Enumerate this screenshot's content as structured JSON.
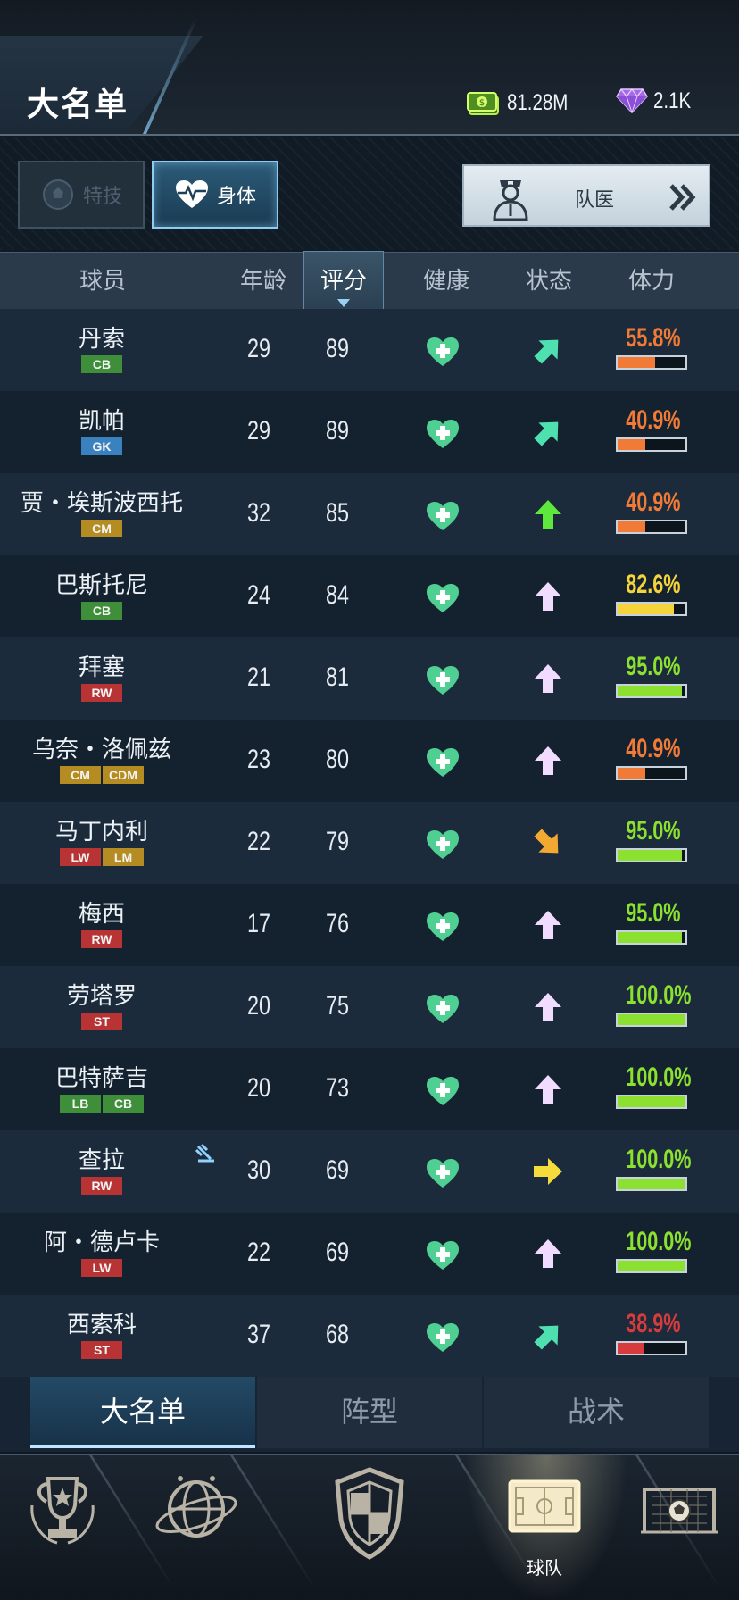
{
  "header": {
    "title": "大名单",
    "money": "81.28M",
    "gems": "2.1K",
    "icons": [
      "cash-icon",
      "diamond-icon"
    ]
  },
  "controls": {
    "tab_skill": "特技",
    "tab_body": "身体",
    "doctor_button": "队医"
  },
  "table": {
    "columns": [
      "球员",
      "年龄",
      "评分",
      "健康",
      "状态",
      "体力"
    ],
    "players": [
      {
        "name": "丹索",
        "positions": [
          "CB"
        ],
        "age": "29",
        "rating": "89",
        "mood": "up-right",
        "stamina": "55.8%",
        "stamina_value": 55.8
      },
      {
        "name": "凯帕",
        "positions": [
          "GK"
        ],
        "age": "29",
        "rating": "89",
        "mood": "up-right",
        "stamina": "40.9%",
        "stamina_value": 40.9
      },
      {
        "name": "贾・埃斯波西托",
        "positions": [
          "CM"
        ],
        "age": "32",
        "rating": "85",
        "mood": "up-green",
        "stamina": "40.9%",
        "stamina_value": 40.9
      },
      {
        "name": "巴斯托尼",
        "positions": [
          "CB"
        ],
        "age": "24",
        "rating": "84",
        "mood": "up",
        "stamina": "82.6%",
        "stamina_value": 82.6
      },
      {
        "name": "拜塞",
        "positions": [
          "RW"
        ],
        "age": "21",
        "rating": "81",
        "mood": "up",
        "stamina": "95.0%",
        "stamina_value": 95.0
      },
      {
        "name": "乌奈・洛佩兹",
        "positions": [
          "CM",
          "CDM"
        ],
        "age": "23",
        "rating": "80",
        "mood": "up",
        "stamina": "40.9%",
        "stamina_value": 40.9
      },
      {
        "name": "马丁内利",
        "positions": [
          "LW",
          "LM"
        ],
        "age": "22",
        "rating": "79",
        "mood": "down-right",
        "stamina": "95.0%",
        "stamina_value": 95.0
      },
      {
        "name": "梅西",
        "positions": [
          "RW"
        ],
        "age": "17",
        "rating": "76",
        "mood": "up",
        "stamina": "95.0%",
        "stamina_value": 95.0
      },
      {
        "name": "劳塔罗",
        "positions": [
          "ST"
        ],
        "age": "20",
        "rating": "75",
        "mood": "up",
        "stamina": "100.0%",
        "stamina_value": 100.0
      },
      {
        "name": "巴特萨吉",
        "positions": [
          "LB",
          "CB"
        ],
        "age": "20",
        "rating": "73",
        "mood": "up",
        "stamina": "100.0%",
        "stamina_value": 100.0
      },
      {
        "name": "查拉",
        "positions": [
          "RW"
        ],
        "age": "30",
        "rating": "69",
        "mood": "right",
        "stamina": "100.0%",
        "stamina_value": 100.0,
        "special": true
      },
      {
        "name": "阿・德卢卡",
        "positions": [
          "LW"
        ],
        "age": "22",
        "rating": "69",
        "mood": "up",
        "stamina": "100.0%",
        "stamina_value": 100.0
      },
      {
        "name": "西索科",
        "positions": [
          "ST"
        ],
        "age": "37",
        "rating": "68",
        "mood": "up-right",
        "stamina": "38.9%",
        "stamina_value": 38.9
      }
    ]
  },
  "subtabs": [
    "大名单",
    "阵型",
    "战术"
  ],
  "bottom_nav": {
    "items": [
      "trophy-icon",
      "globe-icon",
      "shield-icon",
      "pitch-icon",
      "goal-icon"
    ],
    "active_label": "球队"
  },
  "colors": {
    "pos_CB": "#3f8f3a",
    "pos_LB": "#3f8f3a",
    "pos_GK": "#3a82bf",
    "pos_CM": "#b58c21",
    "pos_CDM": "#b58c21",
    "pos_LM": "#b58c21",
    "pos_RW": "#b83434",
    "pos_LW": "#b83434",
    "pos_ST": "#b83434",
    "stamina_orange": "#f07a36",
    "stamina_yellow": "#f5d33a",
    "stamina_green": "#8be030",
    "stamina_red": "#d83b3b",
    "health_green": "#4fcf92"
  }
}
